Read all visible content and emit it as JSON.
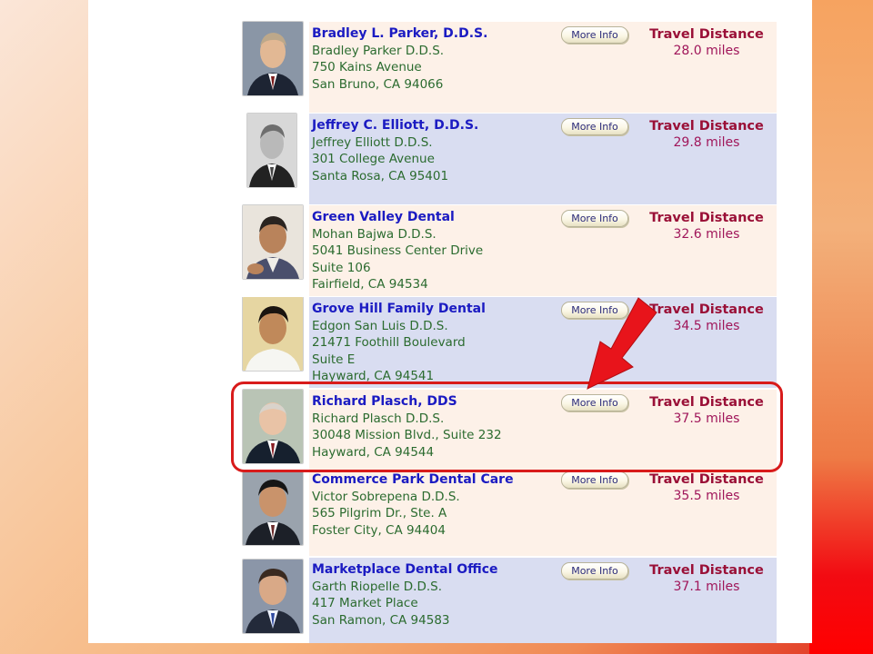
{
  "accent": {
    "name_color": "#1b1bc2",
    "address_color": "#2b6b2f",
    "distance_label_color": "#9a1037",
    "highlight_color": "#d81b1b",
    "row_tint_a": "#fdf1e8",
    "row_tint_b": "#d9ddf1"
  },
  "results": [
    {
      "name": "Bradley L. Parker, D.D.S.",
      "lines": [
        "Bradley Parker D.D.S.",
        "750 Kains Avenue",
        "San Bruno, CA 94066"
      ],
      "button": "More Info",
      "distance_label": "Travel Distance",
      "distance": "28.0 miles"
    },
    {
      "name": "Jeffrey C. Elliott, D.D.S.",
      "lines": [
        "Jeffrey Elliott D.D.S.",
        "301 College Avenue",
        "Santa Rosa, CA 95401"
      ],
      "button": "More Info",
      "distance_label": "Travel Distance",
      "distance": "29.8 miles"
    },
    {
      "name": "Green Valley Dental",
      "lines": [
        "Mohan Bajwa D.D.S.",
        "5041 Business Center Drive",
        "Suite 106",
        "Fairfield, CA 94534"
      ],
      "button": "More Info",
      "distance_label": "Travel Distance",
      "distance": "32.6 miles"
    },
    {
      "name": "Grove Hill Family Dental",
      "lines": [
        "Edgon San Luis D.D.S.",
        "21471 Foothill Boulevard",
        "Suite E",
        "Hayward, CA 94541"
      ],
      "button": "More Info",
      "distance_label": "Travel Distance",
      "distance": "34.5 miles"
    },
    {
      "name": "Richard Plasch, DDS",
      "lines": [
        "Richard Plasch D.D.S.",
        "30048 Mission Blvd., Suite 232",
        "Hayward, CA 94544"
      ],
      "button": "More Info",
      "distance_label": "Travel Distance",
      "distance": "37.5 miles"
    },
    {
      "name": "Commerce Park Dental Care",
      "lines": [
        "Victor Sobrepena D.D.S.",
        "565 Pilgrim Dr., Ste. A",
        "Foster City, CA 94404"
      ],
      "button": "More Info",
      "distance_label": "Travel Distance",
      "distance": "35.5 miles"
    },
    {
      "name": "Marketplace Dental Office",
      "lines": [
        "Garth Riopelle D.D.S.",
        "417 Market Place",
        "San Ramon, CA 94583"
      ],
      "button": "More Info",
      "distance_label": "Travel Distance",
      "distance": "37.1 miles"
    }
  ]
}
